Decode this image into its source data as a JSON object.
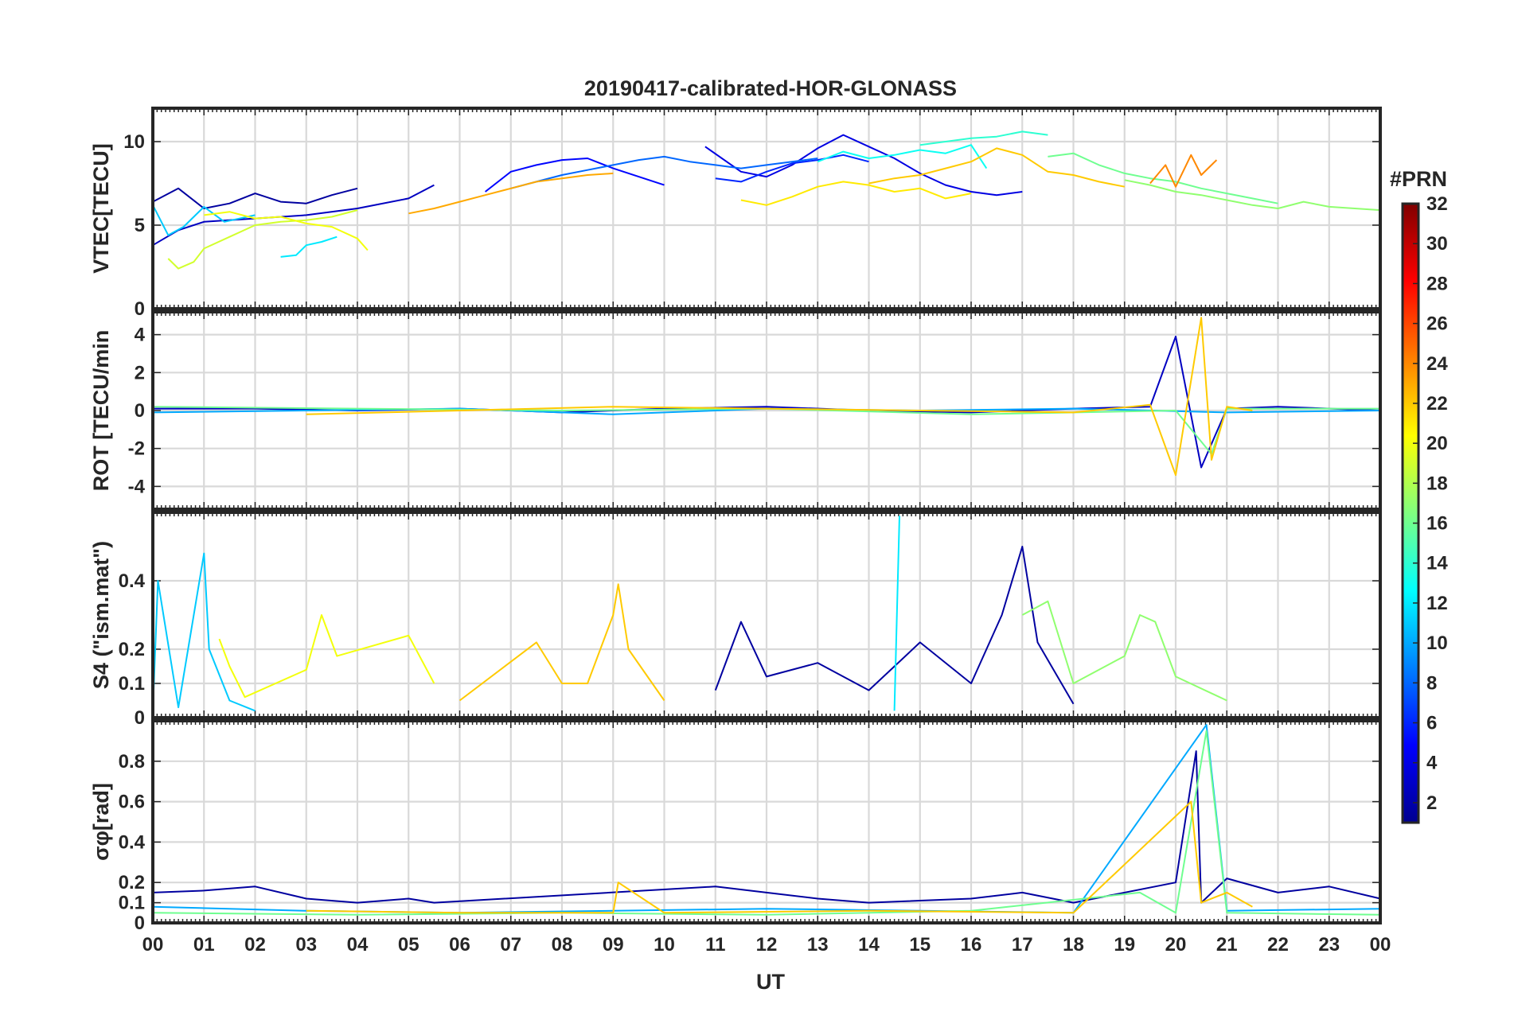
{
  "chart_data": {
    "type": "line",
    "title": "20190417-calibrated-HOR-GLONASS",
    "xlabel": "UT",
    "x_range": [
      0,
      24
    ],
    "x_ticks": [
      "00",
      "01",
      "02",
      "03",
      "04",
      "05",
      "06",
      "07",
      "08",
      "09",
      "10",
      "11",
      "12",
      "13",
      "14",
      "15",
      "16",
      "17",
      "18",
      "19",
      "20",
      "21",
      "22",
      "23",
      "00"
    ],
    "colorbar": {
      "label": "#PRN",
      "range": [
        1,
        32
      ],
      "ticks": [
        "2",
        "4",
        "6",
        "8",
        "10",
        "12",
        "14",
        "16",
        "18",
        "20",
        "22",
        "24",
        "26",
        "28",
        "30",
        "32"
      ],
      "colormap": "jet"
    },
    "panels": [
      {
        "ylabel": "VTEC[TECU]",
        "ylim": [
          0,
          12
        ],
        "yticks": [
          0,
          5,
          10
        ],
        "ytick_labels": [
          "0",
          "5",
          "10"
        ],
        "series": [
          {
            "prn": 2,
            "x": [
              0,
              0.5,
              1,
              1.5,
              2,
              2.5,
              3,
              3.5,
              4
            ],
            "y": [
              6.4,
              7.2,
              6.0,
              6.3,
              6.9,
              6.4,
              6.3,
              6.8,
              7.2
            ]
          },
          {
            "prn": 3,
            "x": [
              0,
              0.5,
              1,
              2,
              3,
              4,
              5,
              5.5
            ],
            "y": [
              3.8,
              4.7,
              5.2,
              5.4,
              5.6,
              6.0,
              6.6,
              7.4
            ]
          },
          {
            "prn": 4,
            "x": [
              10.8,
              11.5,
              12,
              12.5,
              13,
              13.5,
              14,
              14.5,
              15,
              15.5,
              16,
              16.5,
              17
            ],
            "y": [
              9.7,
              8.2,
              7.9,
              8.6,
              9.6,
              10.4,
              9.7,
              9.0,
              8.1,
              7.4,
              7.0,
              6.8,
              7.0
            ]
          },
          {
            "prn": 5,
            "x": [
              6.5,
              7,
              7.5,
              8,
              8.5,
              9,
              9.5,
              10
            ],
            "y": [
              7.0,
              8.2,
              8.6,
              8.9,
              9.0,
              8.4,
              7.9,
              7.4
            ]
          },
          {
            "prn": 6,
            "x": [
              11,
              11.5,
              12,
              12.5,
              13,
              13.5,
              14
            ],
            "y": [
              7.8,
              7.6,
              8.2,
              8.7,
              8.9,
              9.2,
              8.8
            ]
          },
          {
            "prn": 8,
            "x": [
              7,
              7.5,
              8,
              8.5,
              9,
              9.5,
              10,
              10.5,
              11,
              11.5,
              12,
              12.5,
              13
            ],
            "y": [
              7.2,
              7.6,
              8.0,
              8.3,
              8.6,
              8.9,
              9.1,
              8.8,
              8.6,
              8.4,
              8.6,
              8.8,
              9.0
            ]
          },
          {
            "prn": 11,
            "x": [
              0,
              0.3,
              0.6,
              1,
              1.4,
              2
            ],
            "y": [
              6.2,
              4.4,
              4.9,
              6.1,
              5.2,
              5.6
            ]
          },
          {
            "prn": 12,
            "x": [
              2.5,
              2.8,
              3,
              3.3,
              3.6
            ],
            "y": [
              3.1,
              3.2,
              3.8,
              4.0,
              4.3
            ]
          },
          {
            "prn": 13,
            "x": [
              13,
              13.5,
              14,
              14.5,
              15,
              15.5,
              16,
              16.3
            ],
            "y": [
              8.8,
              9.4,
              9.0,
              9.2,
              9.5,
              9.3,
              9.8,
              8.4
            ]
          },
          {
            "prn": 14,
            "x": [
              15,
              15.5,
              16,
              16.5,
              17,
              17.5
            ],
            "y": [
              9.8,
              10.0,
              10.2,
              10.3,
              10.6,
              10.4
            ]
          },
          {
            "prn": 16,
            "x": [
              17.5,
              18,
              18.5,
              19,
              19.5,
              20,
              20.5,
              21,
              21.5,
              22
            ],
            "y": [
              9.1,
              9.3,
              8.6,
              8.1,
              7.8,
              7.6,
              7.2,
              6.9,
              6.6,
              6.3
            ]
          },
          {
            "prn": 17,
            "x": [
              19,
              19.5,
              20,
              20.5,
              21,
              21.5,
              22,
              22.5,
              23,
              23.5,
              24
            ],
            "y": [
              7.7,
              7.4,
              7.0,
              6.8,
              6.5,
              6.2,
              6.0,
              6.4,
              6.1,
              6.0,
              5.9
            ]
          },
          {
            "prn": 19,
            "x": [
              0.3,
              0.5,
              0.8,
              1,
              1.5,
              2,
              2.5,
              3,
              3.5,
              4
            ],
            "y": [
              3.0,
              2.4,
              2.8,
              3.6,
              4.3,
              5.0,
              5.2,
              5.3,
              5.5,
              5.9
            ]
          },
          {
            "prn": 20,
            "x": [
              1,
              1.5,
              2,
              2.5,
              3,
              3.5,
              4,
              4.2
            ],
            "y": [
              5.6,
              5.8,
              5.4,
              5.5,
              5.1,
              4.9,
              4.2,
              3.5
            ]
          },
          {
            "prn": 21,
            "x": [
              11.5,
              12,
              12.5,
              13,
              13.5,
              14,
              14.5,
              15,
              15.5,
              16
            ],
            "y": [
              6.5,
              6.2,
              6.7,
              7.3,
              7.6,
              7.4,
              7.0,
              7.2,
              6.6,
              6.9
            ]
          },
          {
            "prn": 22,
            "x": [
              14,
              14.5,
              15,
              15.5,
              16,
              16.5,
              17,
              17.5,
              18,
              18.5,
              19
            ],
            "y": [
              7.5,
              7.8,
              8.0,
              8.4,
              8.8,
              9.6,
              9.2,
              8.2,
              8.0,
              7.6,
              7.3
            ]
          },
          {
            "prn": 23,
            "x": [
              5,
              5.5,
              6,
              6.5,
              7,
              7.5,
              8,
              8.5,
              9
            ],
            "y": [
              5.7,
              6.0,
              6.4,
              6.8,
              7.2,
              7.6,
              7.8,
              8.0,
              8.1
            ]
          },
          {
            "prn": 24,
            "x": [
              19.5,
              19.8,
              20,
              20.3,
              20.5,
              20.8
            ],
            "y": [
              7.5,
              8.6,
              7.3,
              9.2,
              8.0,
              8.9
            ]
          }
        ]
      },
      {
        "ylabel": "ROT [TECU/min",
        "ylim": [
          -5.2,
          5.2
        ],
        "yticks": [
          -4,
          -2,
          0,
          2,
          4
        ],
        "ytick_labels": [
          "-4",
          "-2",
          "0",
          "2",
          "4"
        ],
        "series": [
          {
            "prn": 3,
            "x": [
              0,
              2,
              4,
              6,
              8,
              10,
              12,
              14,
              16,
              18,
              19.5,
              20,
              20.5,
              21,
              22,
              24
            ],
            "y": [
              0.1,
              0.1,
              0.0,
              0.1,
              -0.1,
              0.1,
              0.2,
              0.0,
              -0.1,
              0.1,
              0.2,
              3.9,
              -3.0,
              0.1,
              0.2,
              0.0
            ]
          },
          {
            "prn": 10,
            "x": [
              0,
              3,
              6,
              9,
              12,
              15,
              18,
              21,
              24
            ],
            "y": [
              -0.1,
              0.0,
              0.1,
              -0.2,
              0.1,
              0.0,
              0.1,
              -0.1,
              0.0
            ]
          },
          {
            "prn": 16,
            "x": [
              0,
              4,
              8,
              12,
              16,
              20,
              20.7,
              21,
              24
            ],
            "y": [
              0.2,
              0.1,
              0.0,
              0.1,
              -0.2,
              0.0,
              -2.3,
              0.1,
              0.1
            ]
          },
          {
            "prn": 22,
            "x": [
              3,
              6,
              9,
              12,
              15,
              18,
              19.5,
              20,
              20.5,
              20.7,
              21,
              21.5
            ],
            "y": [
              -0.2,
              0.0,
              0.2,
              0.1,
              0.0,
              -0.1,
              0.3,
              -3.4,
              4.9,
              -2.6,
              0.2,
              0.0
            ]
          }
        ]
      },
      {
        "ylabel": "S4 (\"ism.mat\")",
        "ylim": [
          0,
          0.6
        ],
        "yticks": [
          0,
          0.1,
          0.2,
          0.4
        ],
        "ytick_labels": [
          "0",
          "0.1",
          "0.2",
          "0.4"
        ],
        "series": [
          {
            "prn": 2,
            "x": [
              11,
              11.5,
              12,
              13,
              14,
              15,
              16,
              16.6,
              17,
              17.3,
              18
            ],
            "y": [
              0.08,
              0.28,
              0.12,
              0.16,
              0.08,
              0.22,
              0.1,
              0.3,
              0.5,
              0.22,
              0.04
            ]
          },
          {
            "prn": 11,
            "x": [
              0,
              0.1,
              0.5,
              1,
              1.1,
              1.5,
              2
            ],
            "y": [
              0.02,
              0.4,
              0.03,
              0.48,
              0.2,
              0.05,
              0.02
            ]
          },
          {
            "prn": 12,
            "x": [
              14.5,
              14.6
            ],
            "y": [
              0.02,
              0.59
            ]
          },
          {
            "prn": 17,
            "x": [
              17,
              17.5,
              18,
              19,
              19.3,
              19.6,
              20,
              21
            ],
            "y": [
              0.3,
              0.34,
              0.1,
              0.18,
              0.3,
              0.28,
              0.12,
              0.05
            ]
          },
          {
            "prn": 20,
            "x": [
              1.3,
              1.5,
              1.8,
              3,
              3.3,
              3.6,
              5,
              5.5
            ],
            "y": [
              0.23,
              0.15,
              0.06,
              0.14,
              0.3,
              0.18,
              0.24,
              0.1
            ]
          },
          {
            "prn": 22,
            "x": [
              6,
              7.5,
              8,
              8.5,
              9,
              9.1,
              9.3,
              10
            ],
            "y": [
              0.05,
              0.22,
              0.1,
              0.1,
              0.3,
              0.39,
              0.2,
              0.05
            ]
          }
        ]
      },
      {
        "ylabel": "σφ[rad]",
        "ylim": [
          0,
          1.0
        ],
        "yticks": [
          0,
          0.1,
          0.2,
          0.4,
          0.6,
          0.8
        ],
        "ytick_labels": [
          "0",
          "0.1",
          "0.2",
          "0.4",
          "0.6",
          "0.8"
        ],
        "series": [
          {
            "prn": 2,
            "x": [
              0,
              1,
              2,
              3,
              4,
              5,
              5.5,
              11,
              12,
              13,
              14,
              16,
              17,
              18,
              20,
              20.4,
              20.5,
              21,
              22,
              23,
              24
            ],
            "y": [
              0.15,
              0.16,
              0.18,
              0.12,
              0.1,
              0.12,
              0.1,
              0.18,
              0.15,
              0.12,
              0.1,
              0.12,
              0.15,
              0.1,
              0.2,
              0.85,
              0.1,
              0.22,
              0.15,
              0.18,
              0.12
            ]
          },
          {
            "prn": 10,
            "x": [
              0,
              3,
              6,
              9,
              12,
              15,
              18,
              20.6,
              21,
              24
            ],
            "y": [
              0.08,
              0.06,
              0.05,
              0.06,
              0.07,
              0.06,
              0.05,
              0.98,
              0.06,
              0.07
            ]
          },
          {
            "prn": 16,
            "x": [
              0,
              4,
              8,
              12,
              16,
              19.3,
              20,
              20.6,
              21,
              24
            ],
            "y": [
              0.05,
              0.04,
              0.05,
              0.04,
              0.06,
              0.15,
              0.05,
              0.95,
              0.05,
              0.04
            ]
          },
          {
            "prn": 22,
            "x": [
              3,
              6,
              9,
              9.1,
              10,
              14,
              18,
              20.3,
              20.5,
              21,
              21.5
            ],
            "y": [
              0.06,
              0.05,
              0.05,
              0.2,
              0.05,
              0.06,
              0.05,
              0.6,
              0.1,
              0.15,
              0.08
            ]
          }
        ]
      }
    ]
  }
}
